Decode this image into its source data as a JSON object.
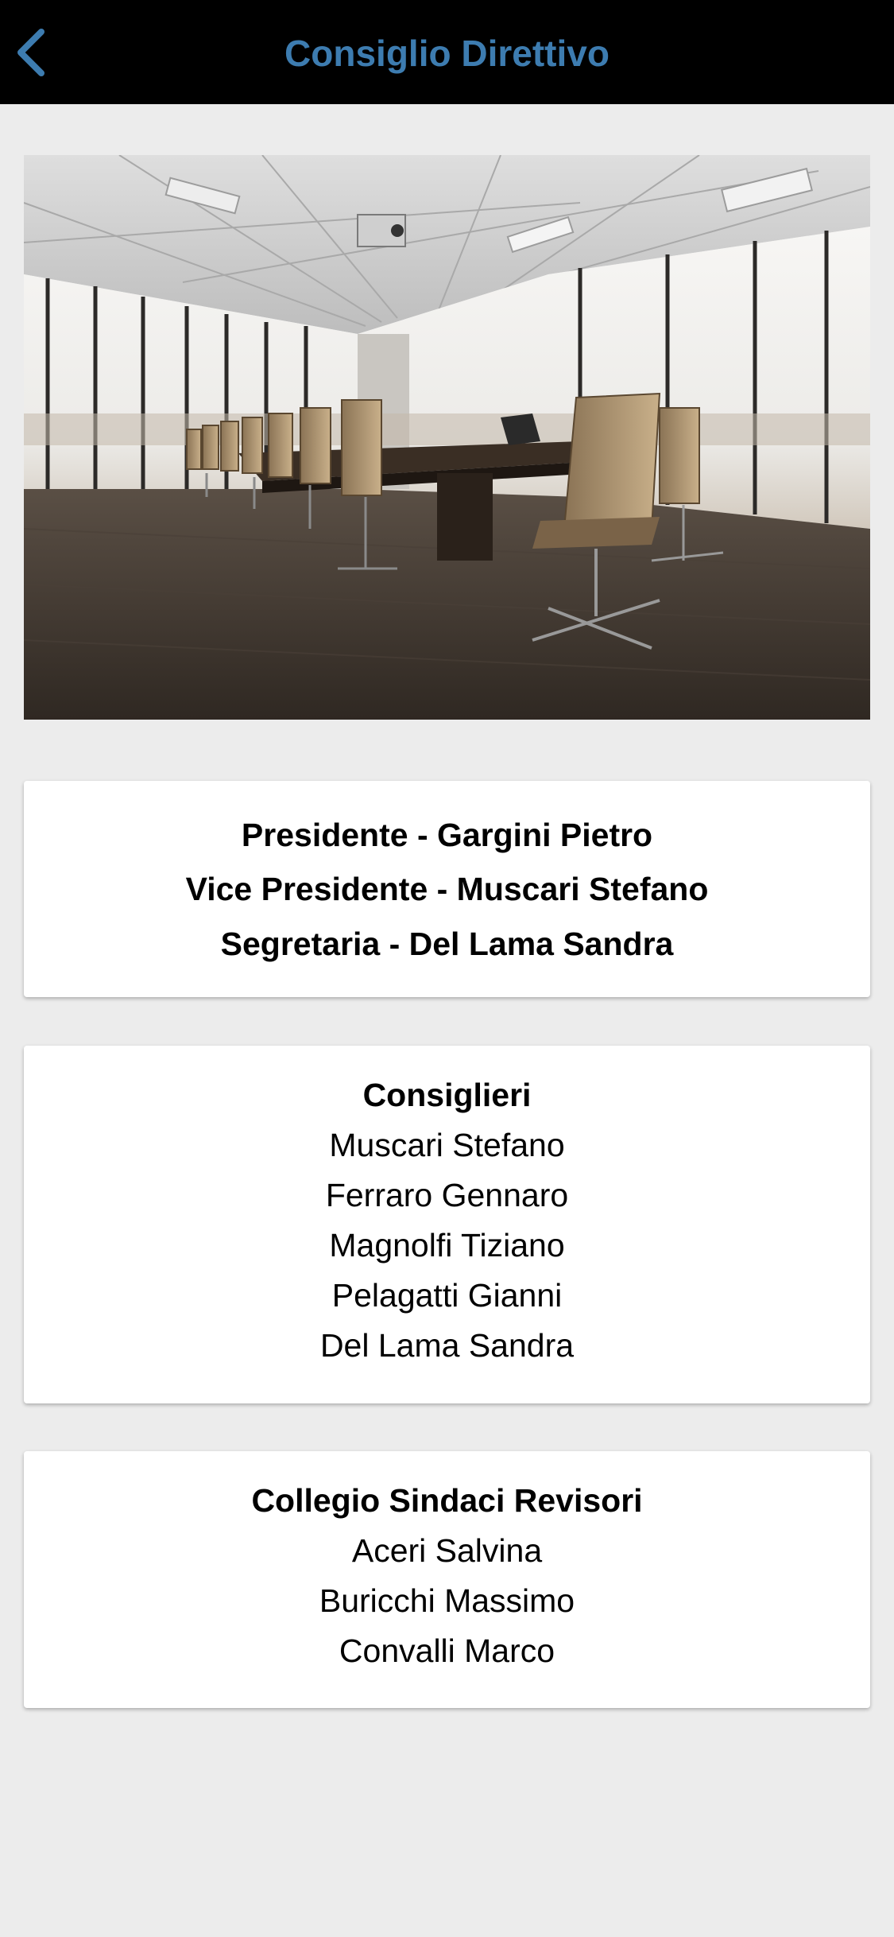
{
  "header": {
    "title": "Consiglio Direttivo",
    "back_icon": "chevron-left-icon",
    "title_color": "#3d7cb0",
    "background": "#000000"
  },
  "hero_image": {
    "subject": "conference-room-photo"
  },
  "officers": [
    "Presidente - Gargini Pietro",
    "Vice Presidente - Muscari Stefano",
    "Segretaria - Del Lama Sandra"
  ],
  "consiglieri": {
    "heading": "Consiglieri",
    "members": [
      "Muscari Stefano",
      "Ferraro Gennaro",
      "Magnolfi Tiziano",
      "Pelagatti Gianni",
      "Del Lama Sandra"
    ]
  },
  "sindaci": {
    "heading": "Collegio Sindaci Revisori",
    "members": [
      "Aceri Salvina",
      "Buricchi Massimo",
      "Convalli Marco"
    ]
  }
}
